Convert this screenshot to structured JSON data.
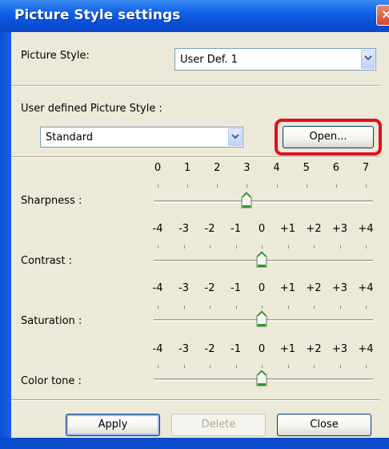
{
  "window": {
    "title": "Picture Style settings",
    "close_glyph": "×"
  },
  "picture_style": {
    "label": "Picture Style:",
    "value": "User Def. 1"
  },
  "user_defined": {
    "label": "User defined Picture Style :",
    "value": "Standard",
    "open_button": "Open..."
  },
  "sliders": {
    "sharpness": {
      "label": "Sharpness :",
      "ticks": [
        "0",
        "1",
        "2",
        "3",
        "4",
        "5",
        "6",
        "7"
      ],
      "value": "3"
    },
    "contrast": {
      "label": "Contrast :",
      "ticks": [
        "-4",
        "-3",
        "-2",
        "-1",
        "0",
        "+1",
        "+2",
        "+3",
        "+4"
      ],
      "value": "0"
    },
    "saturation": {
      "label": "Saturation :",
      "ticks": [
        "-4",
        "-3",
        "-2",
        "-1",
        "0",
        "+1",
        "+2",
        "+3",
        "+4"
      ],
      "value": "0"
    },
    "color_tone": {
      "label": "Color tone :",
      "ticks": [
        "-4",
        "-3",
        "-2",
        "-1",
        "0",
        "+1",
        "+2",
        "+3",
        "+4"
      ],
      "value": "0"
    }
  },
  "buttons": {
    "apply": "Apply",
    "delete": "Delete",
    "close": "Close"
  },
  "colors": {
    "titlebar": "#0a4fd8",
    "dialog_face": "#ece9d8",
    "highlight": "#e0101a",
    "thumb_green": "#2f9a2f"
  },
  "icons": {
    "dropdown": "chevron-down-icon",
    "close": "close-icon",
    "slider_thumb": "slider-thumb-icon"
  }
}
